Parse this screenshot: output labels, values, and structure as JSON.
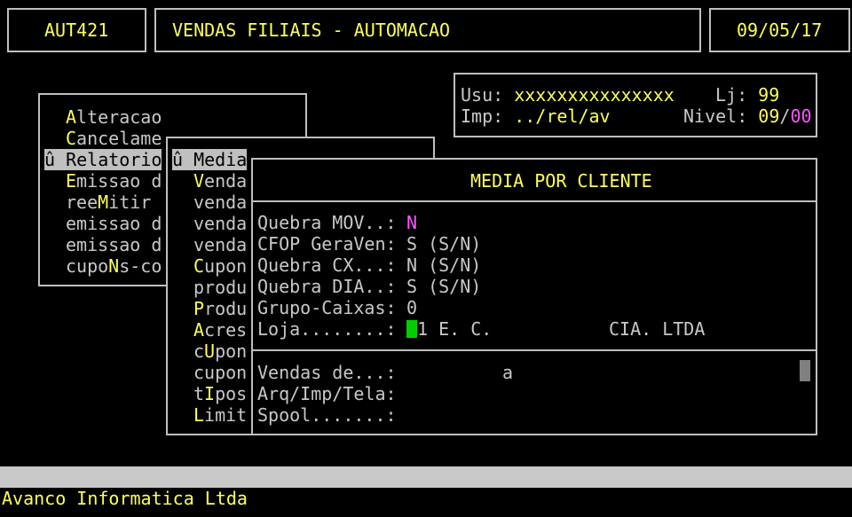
{
  "header": {
    "code": "AUT421",
    "title": "VENDAS FILIAIS - AUTOMACAO",
    "date": "09/05/17"
  },
  "info": {
    "usu_label": "Usu:",
    "usu_value": "xxxxxxxxxxxxxxx",
    "lj_label": "Lj:",
    "lj_value": "99",
    "imp_label": "Imp:",
    "imp_value": "../rel/av",
    "nivel_label": "Nivel:",
    "nivel_value_a": "09",
    "nivel_sep": "/",
    "nivel_value_b": "00"
  },
  "menu1": {
    "items": [
      {
        "hot": "A",
        "rest": "lteracao"
      },
      {
        "hot": "C",
        "rest": "ancelame"
      },
      {
        "selected": "û Relatorio"
      },
      {
        "hot": "E",
        "rest": "missao d"
      },
      {
        "pre": "ree",
        "hot": "M",
        "rest": "itir"
      },
      {
        "pre": "emissao d"
      },
      {
        "pre": "emissao d"
      },
      {
        "pre": "cupo",
        "hot": "N",
        "rest": "s-co"
      }
    ]
  },
  "menu2": {
    "selected": "û Media",
    "items": [
      {
        "hot": "V",
        "rest": "enda"
      },
      {
        "pre": "venda"
      },
      {
        "pre": "venda"
      },
      {
        "pre": "venda"
      },
      {
        "hot": "C",
        "rest": "upon"
      },
      {
        "pre": "produ"
      },
      {
        "hot": "P",
        "rest": "rodu"
      },
      {
        "hot": "A",
        "rest": "cres"
      },
      {
        "pre": "c",
        "hot": "U",
        "rest": "pon"
      },
      {
        "pre": "cupon"
      },
      {
        "pre": "t",
        "hot": "I",
        "rest": "pos"
      },
      {
        "hot": "L",
        "rest": "imit"
      }
    ]
  },
  "dialog": {
    "title": "MEDIA POR CLIENTE",
    "quebra_mov_label": "Quebra MOV..:",
    "quebra_mov_value": "N",
    "cfop_label": "CFOP GeraVen:",
    "cfop_value": "S (S/N)",
    "quebra_cx_label": "Quebra CX...:",
    "quebra_cx_value": "N (S/N)",
    "quebra_dia_label": "Quebra DIA..:",
    "quebra_dia_value": "S (S/N)",
    "grupo_label": "Grupo-Caixas:",
    "grupo_value": "0",
    "loja_label": "Loja........:",
    "loja_value": "1 E. C.",
    "loja_name": "CIA. LTDA",
    "vendas_label": "Vendas de...:",
    "vendas_sep": "a",
    "arq_label": "Arq/Imp/Tela:",
    "spool_label": "Spool.......:"
  },
  "footer": {
    "company": "Avanco Informatica Ltda"
  }
}
